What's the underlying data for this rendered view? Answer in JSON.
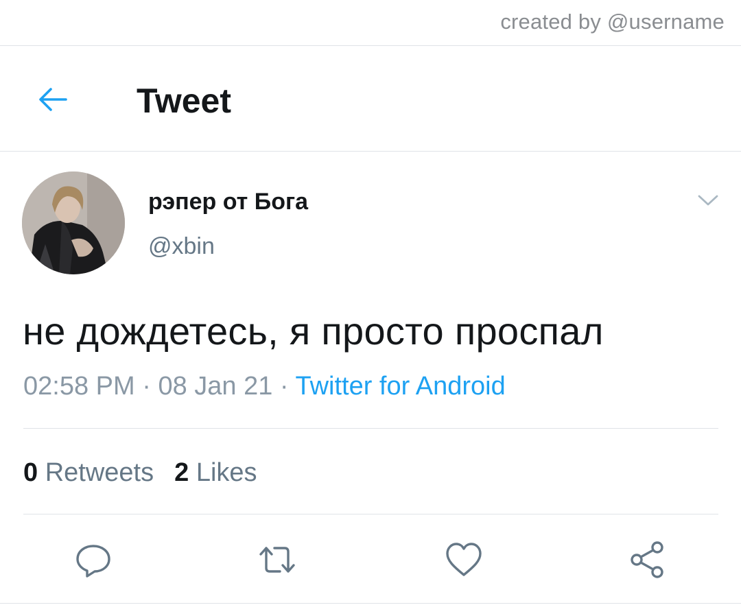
{
  "credit": "created by @username",
  "header": {
    "title": "Tweet"
  },
  "tweet": {
    "display_name": "рэпер от Бога",
    "handle": "@xbin",
    "text": "не дождетесь, я просто проспал",
    "time": "02:58 PM",
    "date": "08 Jan 21",
    "separator": "·",
    "source": "Twitter for Android"
  },
  "stats": {
    "retweets_count": "0",
    "retweets_label": "Retweets",
    "likes_count": "2",
    "likes_label": "Likes"
  },
  "icons": {
    "back": "arrow-left-icon",
    "caret": "chevron-down-icon",
    "reply": "reply-icon",
    "retweet": "retweet-icon",
    "like": "heart-icon",
    "share": "share-icon"
  },
  "colors": {
    "accent": "#1da1f2",
    "text": "#14171a",
    "muted": "#657786",
    "divider": "#dfe3e7"
  }
}
